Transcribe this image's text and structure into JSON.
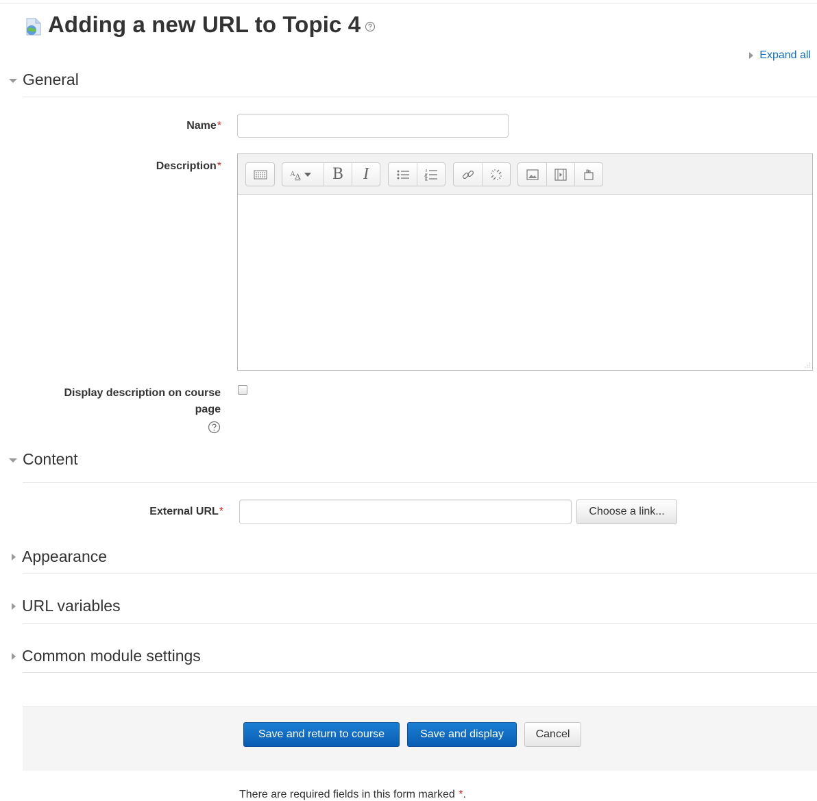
{
  "page": {
    "title": "Adding a new URL to Topic 4",
    "expand_all": "Expand all"
  },
  "sections": {
    "general": "General",
    "content": "Content",
    "appearance": "Appearance",
    "url_variables": "URL variables",
    "common_module_settings": "Common module settings"
  },
  "fields": {
    "name_label": "Name",
    "name_value": "",
    "description_label": "Description",
    "display_description_label_line1": "Display description on course",
    "display_description_label_line2": "page",
    "display_description_checked": false,
    "external_url_label": "External URL",
    "external_url_value": "",
    "choose_link": "Choose a link...",
    "required_mark": "*"
  },
  "editor_toolbar": {
    "buttons": [
      "show-more-icon",
      "font-style-icon",
      "bold-icon",
      "italic-icon",
      "unordered-list-icon",
      "ordered-list-icon",
      "link-icon",
      "unlink-icon",
      "image-icon",
      "media-icon",
      "manage-files-icon"
    ],
    "bold_glyph": "B",
    "italic_glyph": "I"
  },
  "actions": {
    "save_return": "Save and return to course",
    "save_display": "Save and display",
    "cancel": "Cancel"
  },
  "footer": {
    "required_note_prefix": "There are required fields in this form marked ",
    "required_note_mark": "*",
    "required_note_suffix": "."
  },
  "colors": {
    "accent": "#0f6fc5",
    "required": "#d9211d",
    "footer_bg": "#f5f5f5"
  }
}
